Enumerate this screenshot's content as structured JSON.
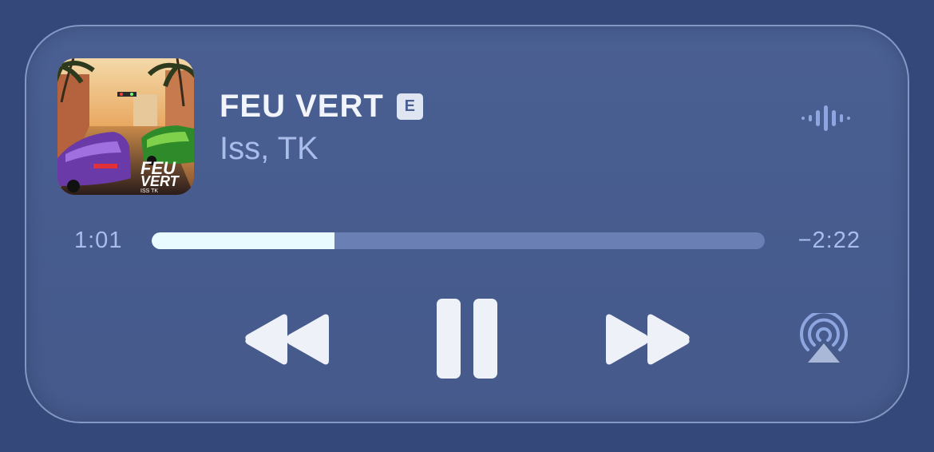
{
  "track": {
    "title": "FEU VERT",
    "explicit_badge": "E",
    "artist": "Iss, TK",
    "artwork": {
      "text_line1": "FEU",
      "text_line2": "VERT",
      "text_line3": "ISS TK"
    }
  },
  "playback": {
    "elapsed": "1:01",
    "remaining": "−2:22",
    "progress_fraction": 0.298,
    "state": "playing"
  },
  "controls": {
    "rewind_icon": "rewind-icon",
    "pause_icon": "pause-icon",
    "forward_icon": "fast-forward-icon",
    "airplay_icon": "airplay-icon",
    "wave_icon": "audio-waveform-icon"
  },
  "colors": {
    "background": "#34487a",
    "card": "#4a5f92",
    "title": "#f1f4fa",
    "secondary": "#a9bcea",
    "progress_fill": "#eafbff",
    "progress_track": "#6a80b4"
  }
}
